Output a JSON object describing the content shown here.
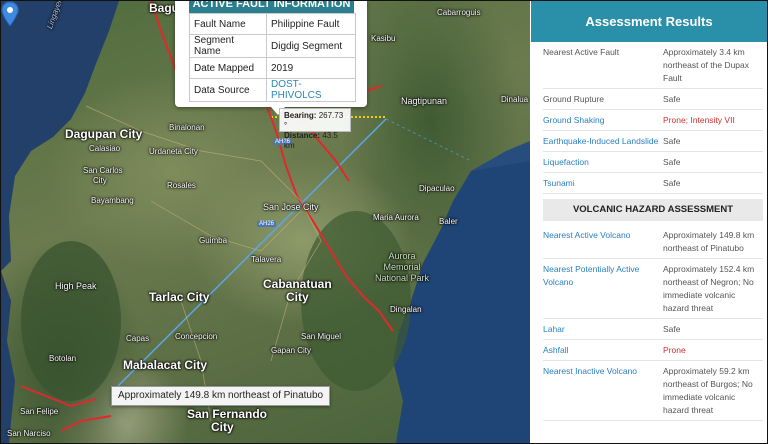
{
  "popup": {
    "title": "ACTIVE FAULT INFORMATION",
    "rows": [
      {
        "key": "Fault Name",
        "value": "Philippine Fault"
      },
      {
        "key": "Segment Name",
        "value": "Digdig Segment"
      },
      {
        "key": "Date Mapped",
        "value": "2019"
      },
      {
        "key": "Data Source",
        "value": "DOST-PHIVOLCS"
      }
    ]
  },
  "measurement": {
    "bearing_label": "Bearing:",
    "bearing_value": "267.73 °",
    "distance_label": "Distance:",
    "distance_value": "43.5 km"
  },
  "tooltip": "Approximately 149.8 km northeast of Pinatubo",
  "map_labels": {
    "baguio": "Baguio",
    "lingayen_gulf": "Lingayen Gulf",
    "kasibu": "Kasibu",
    "cabarroguis": "Cabarroguis",
    "nagtipunan": "Nagtipunan",
    "dinalua": "Dinalua",
    "dagupan": "Dagupan City",
    "binalonan": "Binalonan",
    "calasiao": "Calasiao",
    "urdaneta": "Urdaneta City",
    "san_carlos": "San Carlos",
    "city": "City",
    "rosales": "Rosales",
    "bayambang": "Bayambang",
    "san_jose": "San Jose City",
    "dipaculao": "Dipaculao",
    "maria_aurora": "Maria Aurora",
    "baler": "Baler",
    "guimba": "Guimba",
    "talavera": "Talavera",
    "aurora_park": "Aurora\nMemorial\nNational Park",
    "high_peak": "High Peak",
    "tarlac": "Tarlac City",
    "cabanatuan": "Cabanatuan\nCity",
    "dingalan": "Dingalan",
    "capas": "Capas",
    "concepcion": "Concepcion",
    "san_miguel": "San Miguel",
    "gapan": "Gapan City",
    "botolan": "Botolan",
    "mabalacat": "Mabalacat City",
    "san_felipe": "San Felipe",
    "san_fernando": "San Fernando",
    "san_fernando_city": "City",
    "san_narciso": "San Narciso",
    "road_ah26": "AH26",
    "road_ah26b": "AH26"
  },
  "panel": {
    "title": "Assessment Results",
    "rows": [
      {
        "label": "Nearest Active Fault",
        "value": "Approximately 3.4 km northeast of the Dupax Fault",
        "link": false,
        "alert": false
      },
      {
        "label": "Ground Rupture",
        "value": "Safe",
        "link": false,
        "alert": false
      },
      {
        "label": "Ground Shaking",
        "value": "Prone; Intensity VII",
        "link": true,
        "alert": true
      },
      {
        "label": "Earthquake-Induced Landslide",
        "value": "Safe",
        "link": true,
        "alert": false
      },
      {
        "label": "Liquefaction",
        "value": "Safe",
        "link": true,
        "alert": false
      },
      {
        "label": "Tsunami",
        "value": "Safe",
        "link": true,
        "alert": false
      }
    ],
    "section_title": "VOLCANIC HAZARD ASSESSMENT",
    "volcanic_rows": [
      {
        "label": "Nearest Active Volcano",
        "value": "Approximately 149.8 km northeast of Pinatubo",
        "link": true,
        "alert": false
      },
      {
        "label": "Nearest Potentially Active Volcano",
        "value": "Approximately 152.4 km northeast of Negron; No immediate volcanic hazard threat",
        "link": true,
        "alert": false
      },
      {
        "label": "Lahar",
        "value": "Safe",
        "link": true,
        "alert": false
      },
      {
        "label": "Ashfall",
        "value": "Prone",
        "link": true,
        "alert": true
      },
      {
        "label": "Nearest Inactive Volcano",
        "value": "Approximately 59.2 km northeast of Burgos; No immediate volcanic hazard threat",
        "link": true,
        "alert": false
      }
    ]
  },
  "colors": {
    "panel_header": "#2a8fa8",
    "link": "#2a7fc0",
    "alert": "#d0312d",
    "fault_line": "#e0292b",
    "measure_line": "#f0d000",
    "distance_line": "#5aa7e8"
  }
}
